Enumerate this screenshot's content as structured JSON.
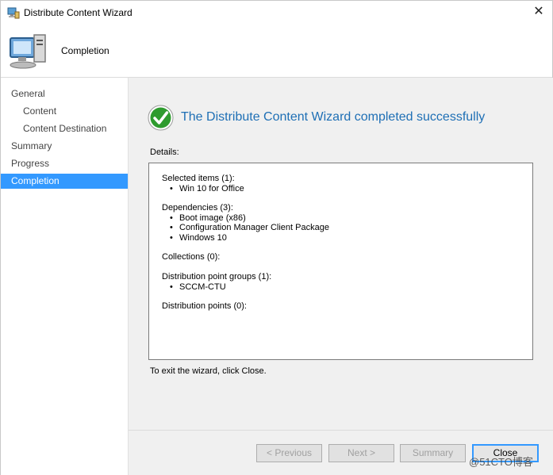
{
  "window": {
    "title": "Distribute Content Wizard"
  },
  "header": {
    "title": "Completion"
  },
  "sidebar": {
    "items": [
      {
        "label": "General"
      },
      {
        "label": "Content"
      },
      {
        "label": "Content Destination"
      },
      {
        "label": "Summary"
      },
      {
        "label": "Progress"
      },
      {
        "label": "Completion"
      }
    ]
  },
  "main": {
    "success_message": "The Distribute Content Wizard completed successfully",
    "details_label": "Details:",
    "details": {
      "selected_items_heading": "Selected items (1):",
      "selected_items": [
        "Win 10 for Office"
      ],
      "dependencies_heading": "Dependencies (3):",
      "dependencies": [
        "Boot image (x86)",
        "Configuration Manager Client Package",
        "Windows 10"
      ],
      "collections_heading": "Collections (0):",
      "dp_groups_heading": "Distribution point groups (1):",
      "dp_groups": [
        "SCCM-CTU"
      ],
      "dps_heading": "Distribution points (0):"
    },
    "exit_text": "To exit the wizard, click Close."
  },
  "buttons": {
    "previous": "< Previous",
    "next": "Next >",
    "summary": "Summary",
    "close": "Close"
  },
  "watermark": "@51CTO博客",
  "colors": {
    "accent": "#3399ff",
    "title_blue": "#1e6fb5",
    "success_green": "#2e9b2e"
  }
}
